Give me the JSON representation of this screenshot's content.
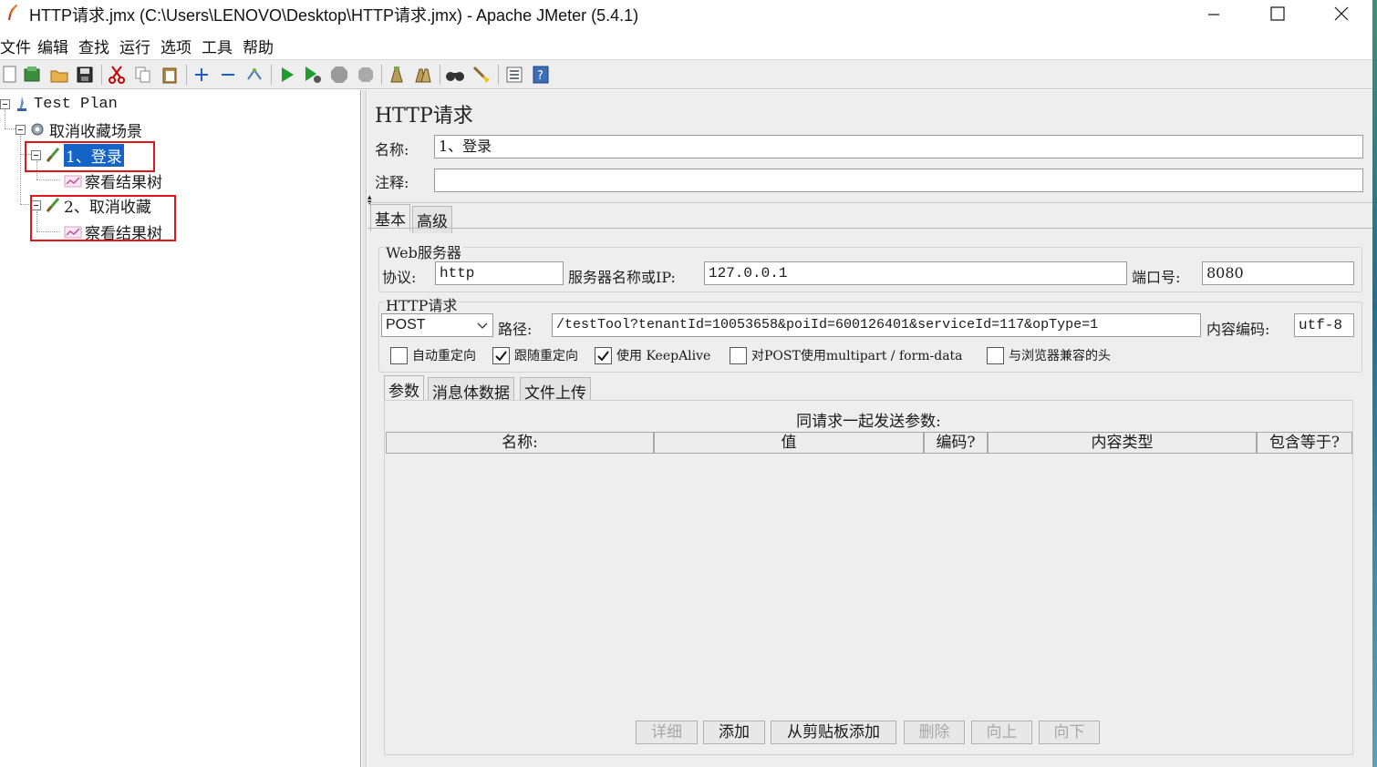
{
  "window": {
    "title": "HTTP请求.jmx (C:\\Users\\LENOVO\\Desktop\\HTTP请求.jmx) - Apache JMeter (5.4.1)"
  },
  "menubar": [
    "文件",
    "编辑",
    "查找",
    "运行",
    "选项",
    "工具",
    "帮助"
  ],
  "toolbar": {
    "icons": [
      "new-icon",
      "templates-icon",
      "open-icon",
      "save-icon",
      "cut-icon",
      "copy-icon",
      "paste-icon",
      "expand-icon",
      "collapse-icon",
      "toggle-icon",
      "start-icon",
      "start-no-pause-icon",
      "stop-icon",
      "shutdown-icon",
      "clear-icon",
      "clear-all-icon",
      "search-icon",
      "reset-search-icon",
      "function-helper-icon",
      "help-icon"
    ]
  },
  "tree": {
    "nodes": [
      {
        "label": "Test Plan",
        "icon": "test-plan-icon"
      },
      {
        "label": "取消收藏场景",
        "icon": "thread-group-icon"
      },
      {
        "label": "1、登录",
        "icon": "sampler-icon",
        "selected": true
      },
      {
        "label": "察看结果树",
        "icon": "listener-icon"
      },
      {
        "label": "2、取消收藏",
        "icon": "sampler-icon"
      },
      {
        "label": "察看结果树",
        "icon": "listener-icon"
      }
    ]
  },
  "panel": {
    "title": "HTTP请求",
    "name_label": "名称:",
    "name_value": "1、登录",
    "comment_label": "注释:",
    "comment_value": "",
    "tabs": [
      "基本",
      "高级"
    ],
    "web_server": {
      "group_label": "Web服务器",
      "protocol_label": "协议:",
      "protocol_value": "http",
      "server_label": "服务器名称或IP:",
      "server_value": "127.0.0.1",
      "port_label": "端口号:",
      "port_value": "8080"
    },
    "http_request": {
      "group_label": "HTTP请求",
      "method": "POST",
      "path_label": "路径:",
      "path_value": "/testTool?tenantId=10053658&poiId=600126401&serviceId=117&opType=1",
      "encoding_label": "内容编码:",
      "encoding_value": "utf-8"
    },
    "checkboxes": [
      {
        "label": "自动重定向",
        "checked": false
      },
      {
        "label": "跟随重定向",
        "checked": true
      },
      {
        "label": "使用 KeepAlive",
        "checked": true
      },
      {
        "label": "对POST使用multipart / form-data",
        "checked": false
      },
      {
        "label": "与浏览器兼容的头",
        "checked": false
      }
    ],
    "sub_tabs": [
      "参数",
      "消息体数据",
      "文件上传"
    ],
    "params": {
      "caption": "同请求一起发送参数:",
      "columns": [
        "名称:",
        "值",
        "编码?",
        "内容类型",
        "包含等于?"
      ]
    },
    "buttons": [
      {
        "label": "详细",
        "enabled": false
      },
      {
        "label": "添加",
        "enabled": true
      },
      {
        "label": "从剪贴板添加",
        "enabled": true
      },
      {
        "label": "删除",
        "enabled": false
      },
      {
        "label": "向上",
        "enabled": false
      },
      {
        "label": "向下",
        "enabled": false
      }
    ]
  }
}
